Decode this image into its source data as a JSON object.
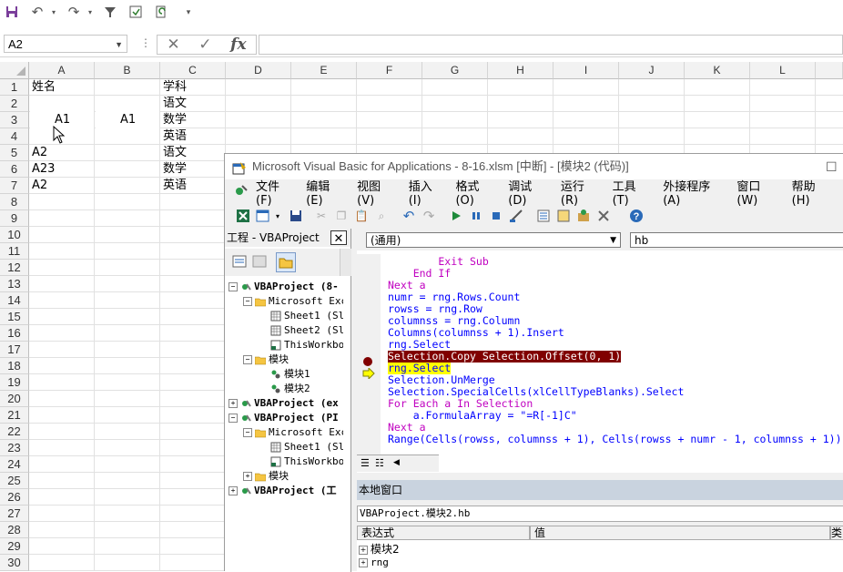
{
  "excel": {
    "name_box": "A2",
    "fx_label": "fx",
    "columns": [
      "A",
      "B",
      "C",
      "D",
      "E",
      "F",
      "G",
      "H",
      "I",
      "J",
      "K",
      "L"
    ],
    "rows": [
      "1",
      "2",
      "3",
      "4",
      "5",
      "6",
      "7",
      "8",
      "9",
      "10",
      "11",
      "12",
      "13",
      "14",
      "15",
      "16",
      "17",
      "18",
      "19",
      "20",
      "21",
      "22",
      "23",
      "24",
      "25",
      "26",
      "27",
      "28",
      "29",
      "30"
    ],
    "cells": {
      "a1": "姓名",
      "c1": "学科",
      "c2": "语文",
      "a3": "A1",
      "b3": "A1",
      "c3": "数学",
      "c4": "英语",
      "a5": "A2",
      "c5": "语文",
      "a6": "A23",
      "c6": "数学",
      "a7": "A2",
      "c7": "英语"
    }
  },
  "vbe": {
    "title": "Microsoft Visual Basic for Applications - 8-16.xlsm [中断] - [模块2 (代码)]",
    "menu": [
      "文件(F)",
      "编辑(E)",
      "视图(V)",
      "插入(I)",
      "格式(O)",
      "调试(D)",
      "运行(R)",
      "工具(T)",
      "外接程序(A)",
      "窗口(W)",
      "帮助(H)"
    ],
    "project_title": "工程 - VBAProject",
    "tree": [
      {
        "text": "VBAProject (8-"
      },
      {
        "text": "Microsoft Exc"
      },
      {
        "text": "Sheet1 (Sl"
      },
      {
        "text": "Sheet2 (Sl"
      },
      {
        "text": "ThisWorkbo"
      },
      {
        "text": "模块"
      },
      {
        "text": "模块1"
      },
      {
        "text": "模块2"
      },
      {
        "text": "VBAProject (ex"
      },
      {
        "text": "VBAProject (PI"
      },
      {
        "text": "Microsoft Exc"
      },
      {
        "text": "Sheet1 (Sl"
      },
      {
        "text": "ThisWorkbo"
      },
      {
        "text": "模块"
      },
      {
        "text": "VBAProject (工"
      }
    ],
    "object_combo": "(通用)",
    "proc_combo": "hb",
    "code": [
      "        Exit Sub",
      "    End If",
      "Next a",
      "numr = rng.Rows.Count",
      "rowss = rng.Row",
      "columnss = rng.Column",
      "Columns(columnss + 1).Insert",
      "rng.Select",
      "Selection.Copy Selection.Offset(0, 1)",
      "rng.Select",
      "Selection.UnMerge",
      "Selection.SpecialCells(xlCellTypeBlanks).Select",
      "For Each a In Selection",
      "    a.FormulaArray = \"=R[-1]C\"",
      "Next a",
      "Range(Cells(rowss, columnss + 1), Cells(rowss + numr - 1, columnss + 1))"
    ],
    "locals_title": "本地窗口",
    "locals_context": "VBAProject.模块2.hb",
    "locals_headers": [
      "表达式",
      "值",
      "类"
    ],
    "locals_rows": [
      "模块2",
      "rng"
    ],
    "colors": {
      "breakpoint": "#800000",
      "exec_line": "#ffff00",
      "keyword": "#0000ff"
    }
  }
}
